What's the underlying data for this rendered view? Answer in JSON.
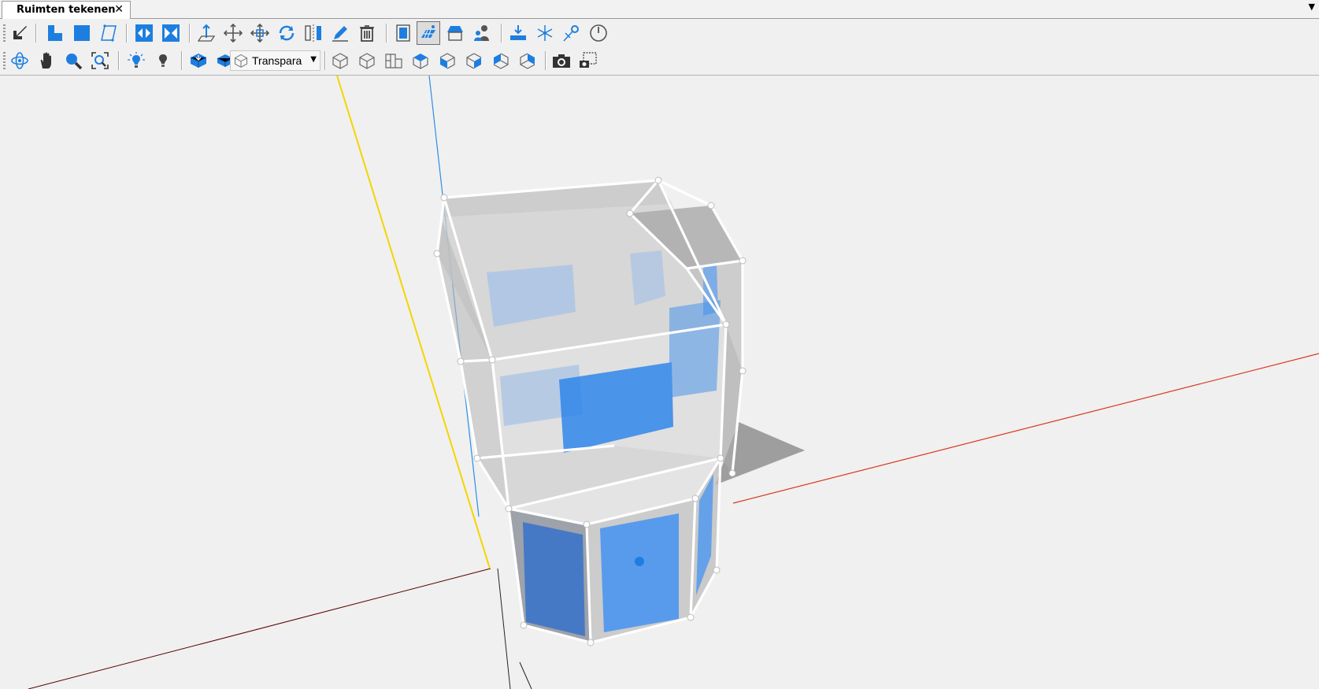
{
  "tab": {
    "title": "Ruimten tekenen",
    "close_icon": "✕",
    "menu_arrow_icon": "▼"
  },
  "toolbar_row1": [
    {
      "name": "select-arrow-icon"
    },
    {
      "name": "draw-l-shape-icon"
    },
    {
      "name": "draw-rectangle-icon"
    },
    {
      "name": "draw-polygon-icon"
    },
    {
      "name": "split-horizontal-icon"
    },
    {
      "name": "merge-horizontal-icon"
    },
    {
      "name": "extrude-icon"
    },
    {
      "name": "move-icon"
    },
    {
      "name": "move-vertex-icon"
    },
    {
      "name": "rotate-icon"
    },
    {
      "name": "mirror-icon"
    },
    {
      "name": "edit-pencil-icon"
    },
    {
      "name": "delete-trash-icon"
    },
    {
      "name": "window-icon"
    },
    {
      "name": "solar-panel-icon"
    },
    {
      "name": "roof-icon"
    },
    {
      "name": "people-icon"
    },
    {
      "name": "ground-level-icon"
    },
    {
      "name": "north-arrow-icon"
    },
    {
      "name": "sun-position-icon"
    },
    {
      "name": "clock-icon"
    }
  ],
  "toolbar_row2": [
    {
      "name": "orbit-icon"
    },
    {
      "name": "pan-hand-icon"
    },
    {
      "name": "zoom-icon"
    },
    {
      "name": "zoom-extents-icon"
    },
    {
      "name": "light-bulb-on-icon"
    },
    {
      "name": "light-bulb-off-icon"
    },
    {
      "name": "render-solid-icon"
    },
    {
      "name": "render-shaded-icon"
    },
    {
      "name": "view-iso-icon"
    },
    {
      "name": "view-iso-2-icon"
    },
    {
      "name": "view-plan-icon"
    },
    {
      "name": "view-top-icon"
    },
    {
      "name": "view-front-icon"
    },
    {
      "name": "view-right-icon"
    },
    {
      "name": "view-left-icon"
    },
    {
      "name": "view-back-icon"
    },
    {
      "name": "camera-icon"
    },
    {
      "name": "camera-region-icon"
    }
  ],
  "display_mode": {
    "selected": "Transpara",
    "icon": "wireframe-cube-icon"
  },
  "colors": {
    "accent": "#1e7ee0",
    "x_axis": "#d9381e",
    "y_axis": "#f2d600",
    "z_axis": "#2b8de8",
    "axis_negative": "#5a0000"
  }
}
